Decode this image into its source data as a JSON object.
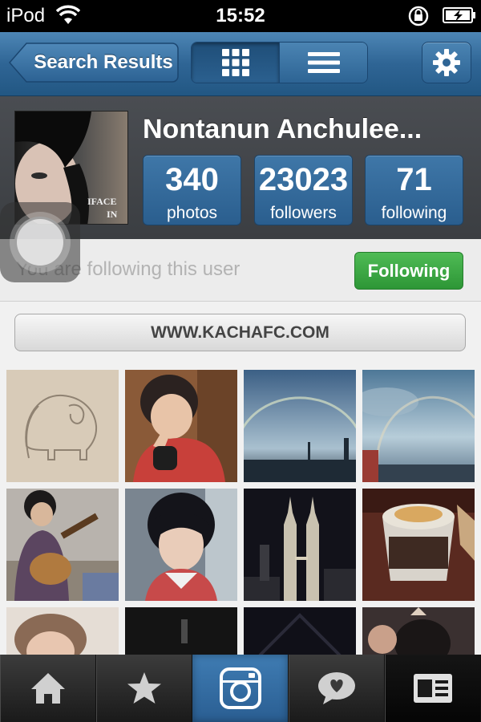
{
  "status_bar": {
    "carrier": "iPod",
    "time": "15:52",
    "icons": [
      "wifi-icon",
      "rotation-lock-icon",
      "battery-charging-icon"
    ]
  },
  "nav": {
    "back_label": "Search Results",
    "view_toggle": {
      "active": "grid-view-icon",
      "inactive": "list-view-icon"
    },
    "settings_icon": "gear-icon"
  },
  "profile": {
    "username": "Nontanun Anchulee...",
    "avatar_text": [
      "IFACE",
      "IN"
    ],
    "stats": [
      {
        "value": "340",
        "label": "photos"
      },
      {
        "value": "23023",
        "label": "followers"
      },
      {
        "value": "71",
        "label": "following"
      }
    ]
  },
  "follow": {
    "status_text": "You are following this user",
    "button_label": "Following"
  },
  "website": {
    "label": "WWW.KACHAFC.COM"
  },
  "photos": [
    "elephant-sketch",
    "selfie-peace-sign",
    "rainbow-sky-1",
    "rainbow-sky-2",
    "guitar-player",
    "car-selfie",
    "petronas-towers-night",
    "coffee-cup-smile",
    "portrait-partial",
    "dark-room",
    "dark-night",
    "crowd-selfie"
  ],
  "tabs": [
    {
      "icon": "home-icon",
      "state": "normal"
    },
    {
      "icon": "star-icon",
      "state": "normal"
    },
    {
      "icon": "camera-icon",
      "state": "active"
    },
    {
      "icon": "heart-bubble-icon",
      "state": "normal"
    },
    {
      "icon": "profile-card-icon",
      "state": "selected-dark"
    }
  ],
  "colors": {
    "nav_blue": "#2f6595",
    "stat_blue": "#3f77a8",
    "following_green": "#3aa843",
    "header_dark": "#43464a"
  }
}
